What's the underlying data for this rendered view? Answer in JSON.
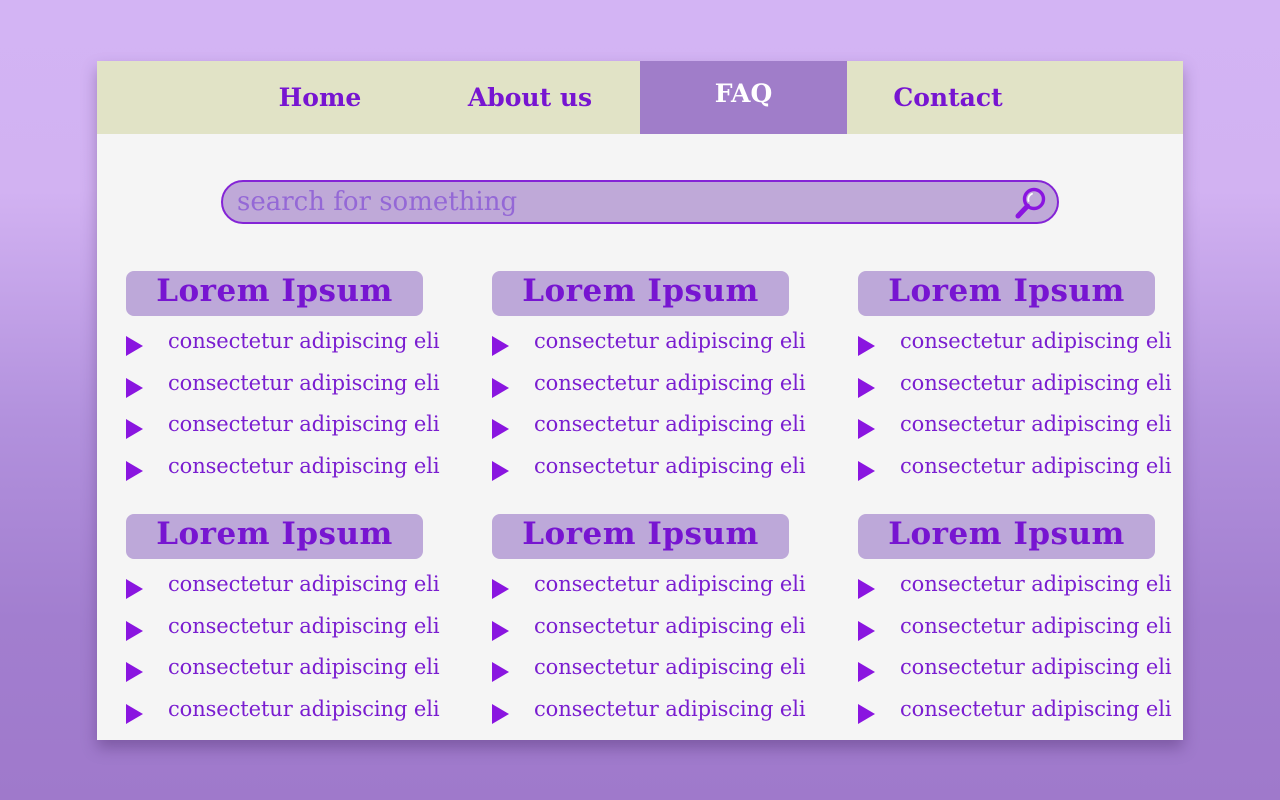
{
  "nav": {
    "items": [
      {
        "label": "Home",
        "active": false
      },
      {
        "label": "About us",
        "active": false
      },
      {
        "label": "FAQ",
        "active": true
      },
      {
        "label": "Contact",
        "active": false
      }
    ]
  },
  "search": {
    "placeholder": "search for something",
    "value": ""
  },
  "sections": [
    {
      "title": "Lorem Ipsum",
      "items": [
        "consectetur adipiscing eli",
        "consectetur adipiscing eli",
        "consectetur adipiscing eli",
        "consectetur adipiscing eli"
      ]
    },
    {
      "title": "Lorem Ipsum",
      "items": [
        "consectetur adipiscing eli",
        "consectetur adipiscing eli",
        "consectetur adipiscing eli",
        "consectetur adipiscing eli"
      ]
    },
    {
      "title": "Lorem Ipsum",
      "items": [
        "consectetur adipiscing eli",
        "consectetur adipiscing eli",
        "consectetur adipiscing eli",
        "consectetur adipiscing eli"
      ]
    },
    {
      "title": "Lorem Ipsum",
      "items": [
        "consectetur adipiscing eli",
        "consectetur adipiscing eli",
        "consectetur adipiscing eli",
        "consectetur adipiscing eli"
      ]
    },
    {
      "title": "Lorem Ipsum",
      "items": [
        "consectetur adipiscing eli",
        "consectetur adipiscing eli",
        "consectetur adipiscing eli",
        "consectetur adipiscing eli"
      ]
    },
    {
      "title": "Lorem Ipsum",
      "items": [
        "consectetur adipiscing eli",
        "consectetur adipiscing eli",
        "consectetur adipiscing eli",
        "consectetur adipiscing eli"
      ]
    }
  ],
  "icons": {
    "search": "magnifier-icon",
    "bullet": "play-arrow-icon"
  },
  "colors": {
    "accent": "#7715d1",
    "active_tab": "#a07dc9",
    "navbar": "#e1e3c6",
    "panel": "#f5f5f5",
    "title_bg": "#bda8d9"
  }
}
